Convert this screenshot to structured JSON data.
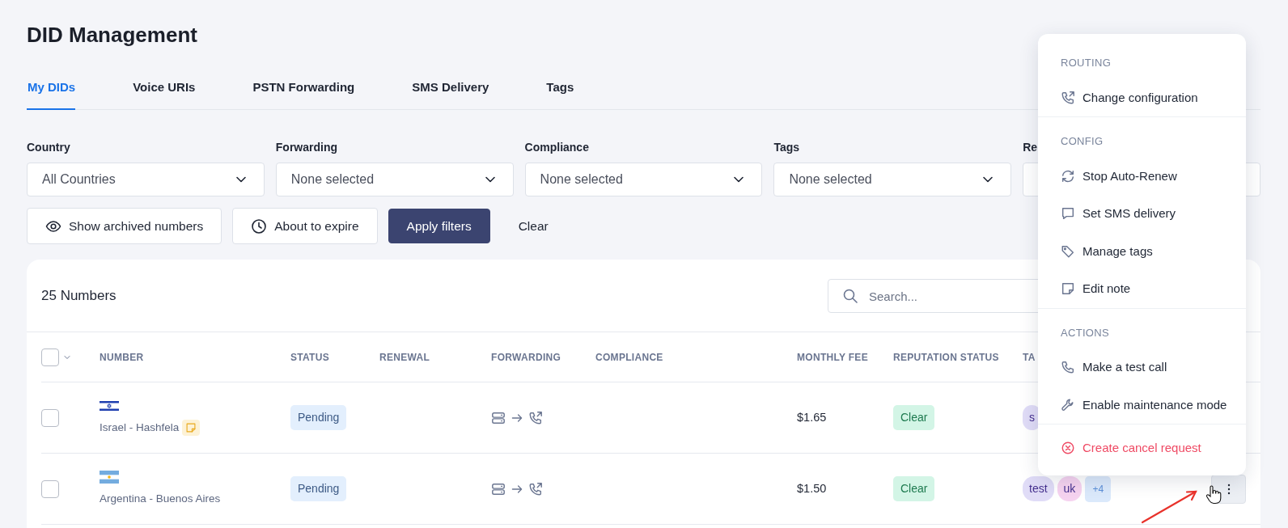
{
  "page_title": "DID Management",
  "tabs": [
    {
      "label": "My DIDs",
      "selected": true
    },
    {
      "label": "Voice URIs",
      "selected": false
    },
    {
      "label": "PSTN Forwarding",
      "selected": false
    },
    {
      "label": "SMS Delivery",
      "selected": false
    },
    {
      "label": "Tags",
      "selected": false
    }
  ],
  "filters": [
    {
      "label": "Country",
      "value": "All Countries"
    },
    {
      "label": "Forwarding",
      "value": "None selected"
    },
    {
      "label": "Compliance",
      "value": "None selected"
    },
    {
      "label": "Tags",
      "value": "None selected"
    },
    {
      "label": "Re"
    }
  ],
  "filter_buttons": [
    {
      "label": "Show archived numbers",
      "kind": "eye"
    },
    {
      "label": "About to expire",
      "kind": "clock"
    },
    {
      "label": "Apply filters",
      "kind": "primary"
    },
    {
      "label": "Clear",
      "kind": "link"
    }
  ],
  "table": {
    "count": "25 Numbers",
    "search": {
      "placeholder": "Search..."
    },
    "select_all": {
      "checked": false
    },
    "columns": [
      "NUMBER",
      "STATUS",
      "RENEWAL",
      "FORWARDING",
      "COMPLIANCE",
      "MONTHLY FEE",
      "REPUTATION STATUS",
      "TA"
    ],
    "rows": [
      {
        "checked": false,
        "number": "Israel - Hashfela",
        "note": true,
        "status": {
          "text": "Pending",
          "kind": "pending"
        },
        "monthly_fee": "$1.65",
        "reputation": {
          "text": "Clear",
          "kind": "clear"
        },
        "tags": [
          {
            "text": "s",
            "color": "#e0dcf7",
            "kind": "tag"
          }
        ],
        "actions_button": false
      },
      {
        "checked": false,
        "number": "Argentina - Buenos Aires",
        "note": false,
        "status": {
          "text": "Pending",
          "kind": "pending"
        },
        "monthly_fee": "$1.50",
        "reputation": {
          "text": "Clear",
          "kind": "clear"
        },
        "tags": [
          {
            "text": "test",
            "color": "#e0dcf7",
            "kind": "tag"
          },
          {
            "text": "uk",
            "color": "#f6d3f0",
            "kind": "tag"
          },
          {
            "text": "+4",
            "color": "#dbe9fb",
            "kind": "more"
          }
        ],
        "actions_button": true
      }
    ]
  },
  "menu": [
    {
      "heading": "ROUTING",
      "items": [
        {
          "label": "Change configuration",
          "kind": "normal"
        }
      ]
    },
    {
      "heading": "CONFIG",
      "items": [
        {
          "label": "Stop Auto-Renew",
          "kind": "normal"
        },
        {
          "label": "Set SMS delivery",
          "kind": "normal"
        },
        {
          "label": "Manage tags",
          "kind": "normal"
        },
        {
          "label": "Edit note",
          "kind": "normal"
        }
      ]
    },
    {
      "heading": "ACTIONS",
      "items": [
        {
          "label": "Make a test call",
          "kind": "normal"
        },
        {
          "label": "Enable maintenance mode",
          "kind": "normal"
        }
      ]
    },
    {
      "items": [
        {
          "label": "Create cancel request",
          "kind": "danger"
        }
      ]
    }
  ]
}
